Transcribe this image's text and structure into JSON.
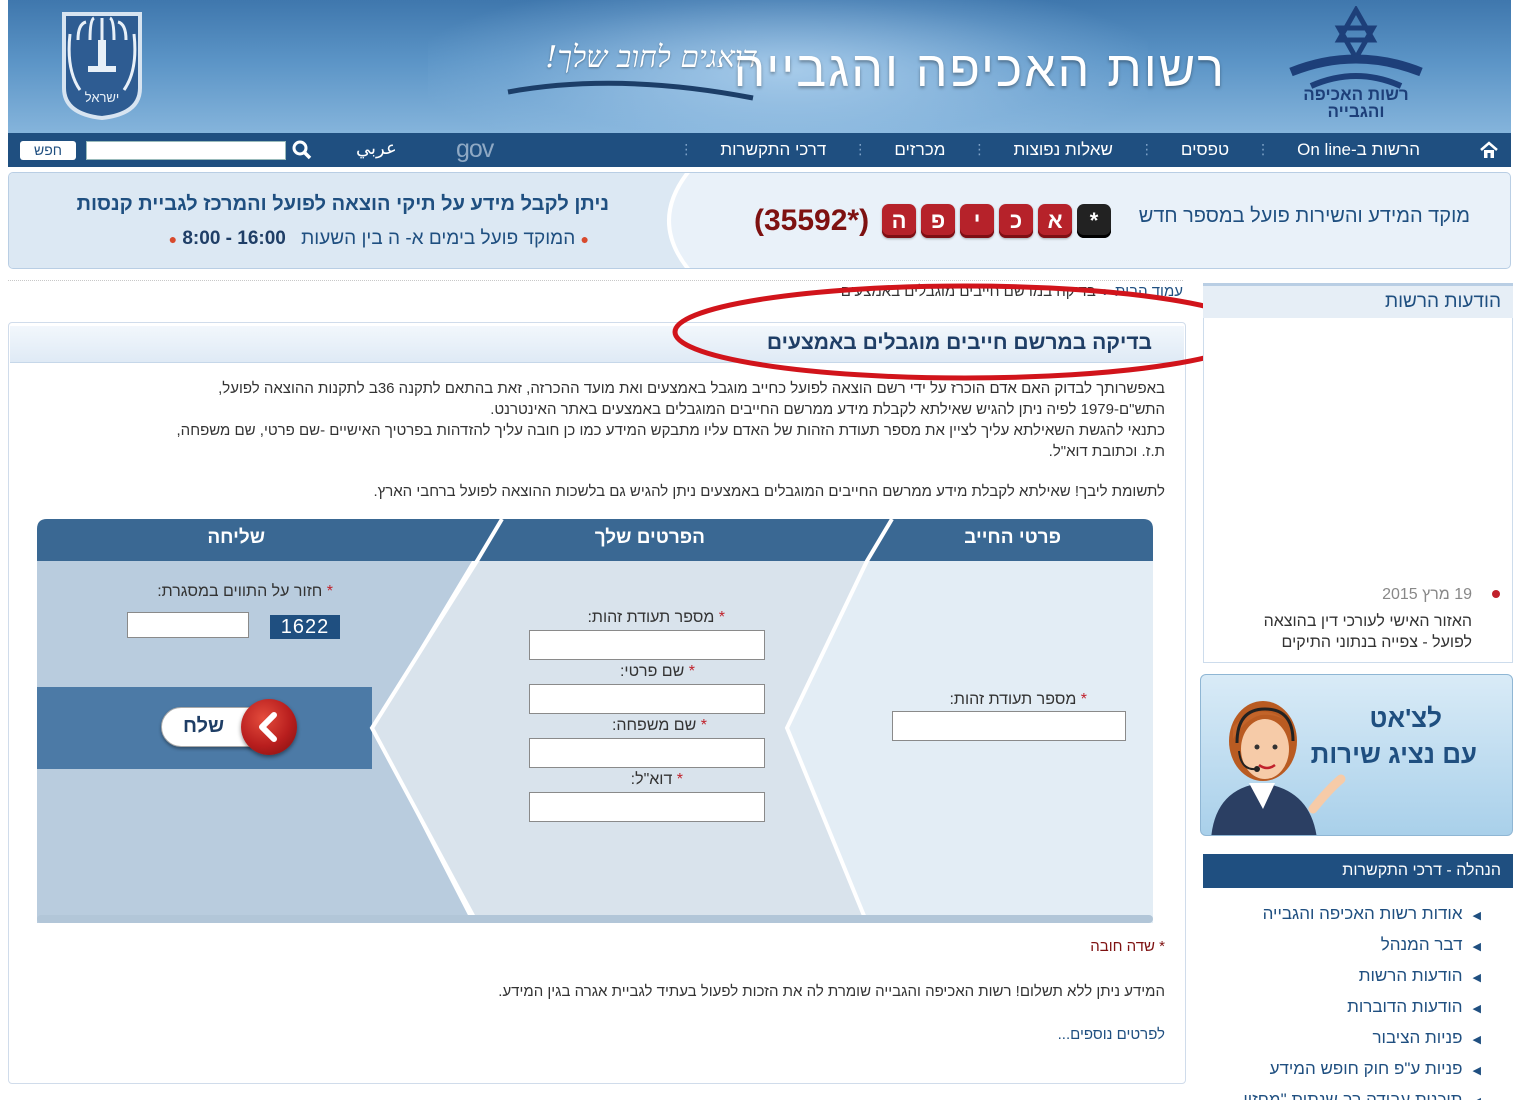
{
  "header": {
    "site_title": "רשות האכיפה והגבייה",
    "slogan": "דואגים לחוב שלך!",
    "logo_text_line1": "רשות האכיפה",
    "logo_text_line2": "והגבייה",
    "emblem_text": "ישראל"
  },
  "nav": {
    "items": [
      "הרשות ב-On line",
      "טפסים",
      "שאלות נפוצות",
      "מכרזים",
      "דרכי התקשרות"
    ],
    "gov_label": "gov",
    "arabic_label": "عربي",
    "search_placeholder": "",
    "search_button": "חפש"
  },
  "banner": {
    "right_text": "מוקד המידע והשירות פועל במספר חדש",
    "keys": [
      "*",
      "א",
      "כ",
      "י",
      "פ",
      "ה"
    ],
    "phone": "(35592*)",
    "left_line1": "ניתן לקבל מידע על תיקי הוצאה לפועל והמרכז לגביית קנסות",
    "left_line2": "המוקד פועל בימים א- ה בין השעות",
    "left_hours": "16:00 - 8:00"
  },
  "breadcrumb": {
    "home": "עמוד הבית",
    "current": "בדיקה במרשם חייבים מוגבלים באמצעים"
  },
  "main": {
    "page_title": "בדיקה במרשם חייבים מוגבלים באמצעים",
    "intro_lines": [
      "באפשרותך לבדוק האם אדם הוכרז על ידי רשם הוצאה לפועל כחייב מוגבל באמצעים ואת מועד ההכרזה, זאת בהתאם לתקנה 36ב לתקנות ההוצאה לפועל,",
      "התש\"ם-1979 לפיה ניתן להגיש שאילתא לקבלת מידע ממרשם החייבים המוגבלים באמצעים באתר האינטרנט.",
      "כתנאי להגשת השאילתא עליך לציין את מספר תעודת הזהות של האדם עליו מתבקש המידע כמו כן חובה עליך להזדהות בפרטיך האישיים -שם פרטי, שם משפחה,",
      "ת.ז. וכתובת דוא\"ל."
    ],
    "note": "לתשומת ליבך! שאילתא לקבלת מידע ממרשם החייבים המוגבלים באמצעים ניתן להגיש גם בלשכות ההוצאה לפועל ברחבי הארץ.",
    "required_note": "* שדה חובה",
    "free_note": "המידע ניתן ללא תשלום! רשות האכיפה והגבייה שומרת לה את הזכות לפעול בעתיד לגביית אגרה בגין המידע.",
    "more_link": "לפרטים נוספים..."
  },
  "form": {
    "col_debtor": "פרטי החייב",
    "col_yours": "הפרטים שלך",
    "col_send": "שליחה",
    "debtor_id_label": "מספר תעודת זהות:",
    "your_id_label": "מספר תעודת זהות:",
    "first_name_label": "שם פרטי:",
    "last_name_label": "שם משפחה:",
    "email_label": "דוא\"ל:",
    "captcha_label": "חזור על התווים במסגרת:",
    "captcha_value": "1622",
    "required_mark": "*",
    "send_label": "שלח"
  },
  "sidebar": {
    "news_title": "הודעות הרשות",
    "news_date": "19 מרץ 2015",
    "news_text": "האזור האישי לעורכי דין בהוצאה לפועל - צפייה בנתוני התיקים",
    "chat_line1": "לצ'אט",
    "chat_line2": "עם נציג שירות",
    "mgmt_title": "הנהלה - דרכי התקשרות",
    "mgmt_items": [
      "אודות רשות האכיפה והגבייה",
      "דבר המנהל",
      "הודעות הרשות",
      "הודעות הדוברות",
      "פניות הציבור",
      "פניות ע\"פ חוק חופש המידע",
      "תוכנית עבודה רב שנתית \"מחזון"
    ]
  },
  "colors": {
    "nav_bg": "#1f4f80",
    "accent_red": "#c0212b",
    "form_head": "#3a6893",
    "annotation_ellipse": "#d1141b"
  }
}
